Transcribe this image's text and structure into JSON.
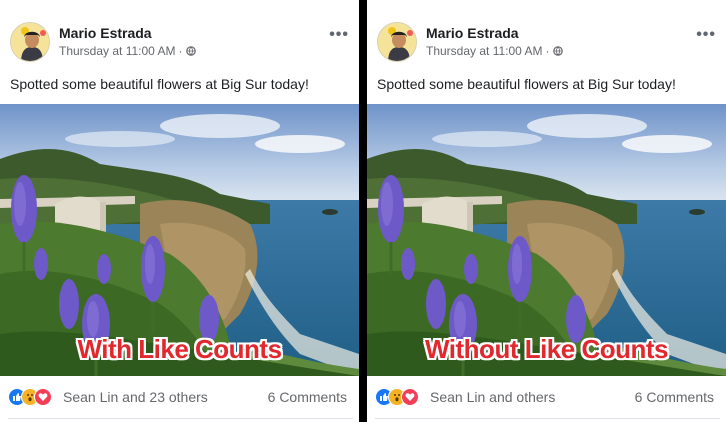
{
  "posts": [
    {
      "author": "Mario Estrada",
      "timestamp": "Thursday at 11:00 AM",
      "separator": "·",
      "text": "Spotted some beautiful flowers at Big Sur today!",
      "overlay_label": "With Like Counts",
      "reactions_text": "Sean Lin and 23 others",
      "comments_text": "6 Comments"
    },
    {
      "author": "Mario Estrada",
      "timestamp": "Thursday at 11:00 AM",
      "separator": "·",
      "text": "Spotted some beautiful flowers at Big Sur today!",
      "overlay_label": "Without Like Counts",
      "reactions_text": "Sean Lin and others",
      "comments_text": "6 Comments"
    }
  ],
  "icons": {
    "more": "more-options-icon",
    "privacy": "globe-icon",
    "reactions": [
      "like-icon",
      "wow-icon",
      "love-icon"
    ]
  },
  "colors": {
    "overlay_text": "#e0282e",
    "like": "#1877f2",
    "wow": "#f7b125",
    "love": "#f33e58"
  }
}
